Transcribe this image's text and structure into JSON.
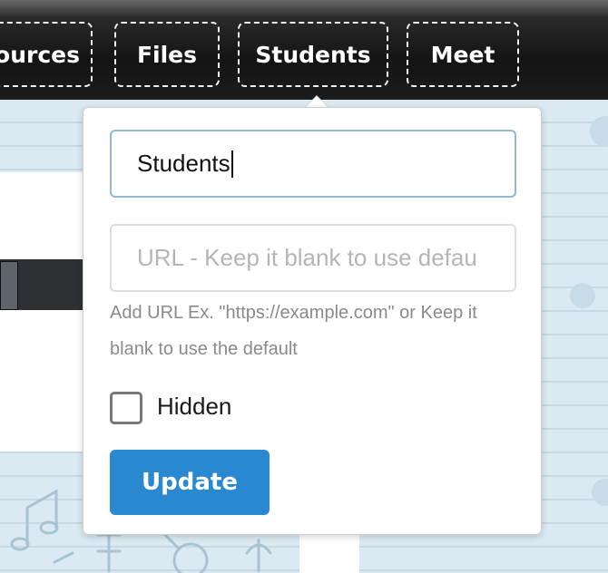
{
  "nav": {
    "tabs": [
      {
        "label": "ources"
      },
      {
        "label": "Files"
      },
      {
        "label": "Students"
      },
      {
        "label": "Meet"
      }
    ]
  },
  "popover": {
    "title_value": "Students",
    "url_placeholder": "URL - Keep it blank to use defau",
    "url_value": "",
    "help_text": "Add URL Ex. \"https://example.com\" or Keep it blank to use the default",
    "hidden_label": "Hidden",
    "hidden_checked": false,
    "update_label": "Update"
  },
  "colors": {
    "accent": "#2a88d0",
    "focus_border": "#8fb8d2",
    "nav_bg": "#141414",
    "page_bg": "#dbeaf2"
  }
}
